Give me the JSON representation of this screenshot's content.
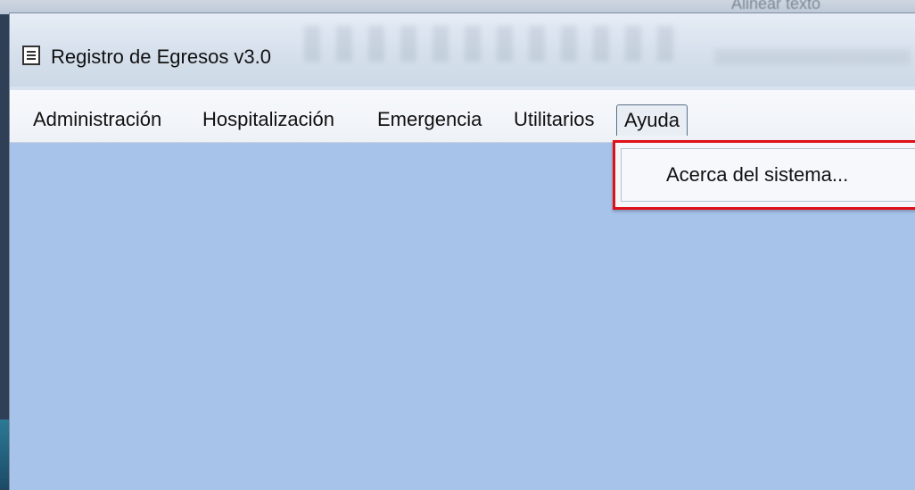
{
  "background": {
    "text": "Alinear texto"
  },
  "window": {
    "title": "Registro de Egresos v3.0"
  },
  "menubar": {
    "items": [
      {
        "label": "Administración"
      },
      {
        "label": "Hospitalización"
      },
      {
        "label": "Emergencia"
      },
      {
        "label": "Utilitarios"
      },
      {
        "label": "Ayuda"
      }
    ]
  },
  "dropdown": {
    "items": [
      {
        "label": "Acerca del sistema..."
      }
    ]
  },
  "colors": {
    "client_area": "#a7c3ea",
    "highlight": "#e01019"
  }
}
